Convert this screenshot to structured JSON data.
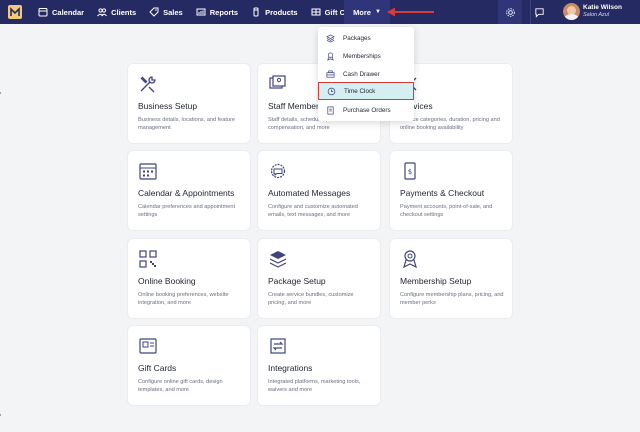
{
  "nav": {
    "items": [
      {
        "label": "Calendar",
        "icon": "calendar-icon"
      },
      {
        "label": "Clients",
        "icon": "clients-icon"
      },
      {
        "label": "Sales",
        "icon": "tag-icon"
      },
      {
        "label": "Reports",
        "icon": "reports-icon"
      },
      {
        "label": "Products",
        "icon": "products-icon"
      },
      {
        "label": "Gift Cards",
        "icon": "gift-card-icon"
      }
    ],
    "more_label": "More",
    "user_name": "Katie Wilson",
    "salon_name": "Salon Azul"
  },
  "dropdown": {
    "items": [
      {
        "label": "Packages",
        "icon": "packages-icon"
      },
      {
        "label": "Memberships",
        "icon": "memberships-icon"
      },
      {
        "label": "Cash Drawer",
        "icon": "cash-drawer-icon"
      },
      {
        "label": "Time Clock",
        "icon": "clock-icon",
        "selected": true
      },
      {
        "label": "Purchase Orders",
        "icon": "purchase-orders-icon"
      }
    ]
  },
  "cards": [
    {
      "title": "Business Setup",
      "desc": "Business details, locations, and feature management",
      "icon": "tools-icon"
    },
    {
      "title": "Staff Members",
      "desc": "Staff details, schedules, and compensation, and more",
      "icon": "staff-icon"
    },
    {
      "title": "Services",
      "desc": "Service categories, duration, pricing and online booking availability",
      "icon": "services-icon"
    },
    {
      "title": "Calendar & Appointments",
      "desc": "Calendar preferences and appointment settings",
      "icon": "calendar-icon"
    },
    {
      "title": "Automated Messages",
      "desc": "Configure and customize automated emails, text messages, and more",
      "icon": "messages-icon"
    },
    {
      "title": "Payments & Checkout",
      "desc": "Payment accounts, point-of-sale, and checkout settings",
      "icon": "payments-icon"
    },
    {
      "title": "Online Booking",
      "desc": "Online booking preferences, website integration, and more",
      "icon": "qr-icon"
    },
    {
      "title": "Package Setup",
      "desc": "Create service bundles, customize pricing, and more",
      "icon": "stack-icon"
    },
    {
      "title": "Membership Setup",
      "desc": "Configure membership plans, pricing, and member perks",
      "icon": "badge-icon"
    },
    {
      "title": "Gift Cards",
      "desc": "Configure online gift cards, design templates, and more",
      "icon": "gift-card-icon"
    },
    {
      "title": "Integrations",
      "desc": "Integrated platforms, marketing tools, waivers and more",
      "icon": "integrations-icon"
    }
  ],
  "colors": {
    "nav_bg": "#262a63",
    "accent": "#4b4f9c",
    "highlight": "#d5eef1",
    "annotation_red": "#d63a3a"
  }
}
